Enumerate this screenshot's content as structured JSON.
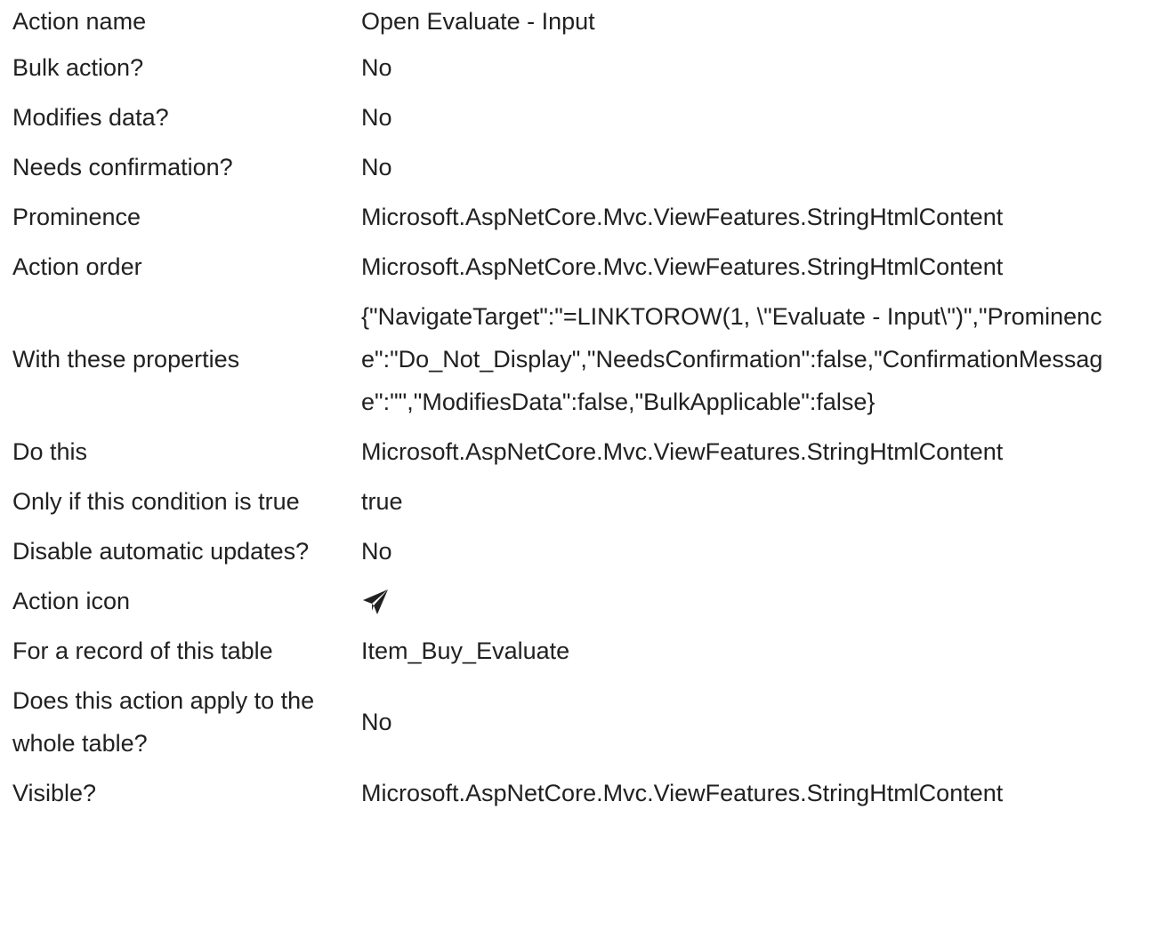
{
  "rows": [
    {
      "label": "Action name",
      "value": "Open Evaluate - Input"
    },
    {
      "label": "Bulk action?",
      "value": "No"
    },
    {
      "label": "Modifies data?",
      "value": "No"
    },
    {
      "label": "Needs confirmation?",
      "value": "No"
    },
    {
      "label": "Prominence",
      "value": "Microsoft.AspNetCore.Mvc.ViewFeatures.StringHtmlContent"
    },
    {
      "label": "Action order",
      "value": "Microsoft.AspNetCore.Mvc.ViewFeatures.StringHtmlContent"
    },
    {
      "label": "With these properties",
      "value": "{\"NavigateTarget\":\"=LINKTOROW(1, \\\"Evaluate - Input\\\")\",\"Prominence\":\"Do_Not_Display\",\"NeedsConfirmation\":false,\"ConfirmationMessage\":\"\",\"ModifiesData\":false,\"BulkApplicable\":false}"
    },
    {
      "label": "Do this",
      "value": "Microsoft.AspNetCore.Mvc.ViewFeatures.StringHtmlContent"
    },
    {
      "label": "Only if this condition is true",
      "value": "true"
    },
    {
      "label": "Disable automatic updates?",
      "value": "No"
    },
    {
      "label": "Action icon",
      "value": "",
      "icon": "paper-plane-icon"
    },
    {
      "label": "For a record of this table",
      "value": "Item_Buy_Evaluate"
    },
    {
      "label": "Does this action apply to the whole table?",
      "value": "No"
    },
    {
      "label": "Visible?",
      "value": "Microsoft.AspNetCore.Mvc.ViewFeatures.StringHtmlContent"
    }
  ]
}
